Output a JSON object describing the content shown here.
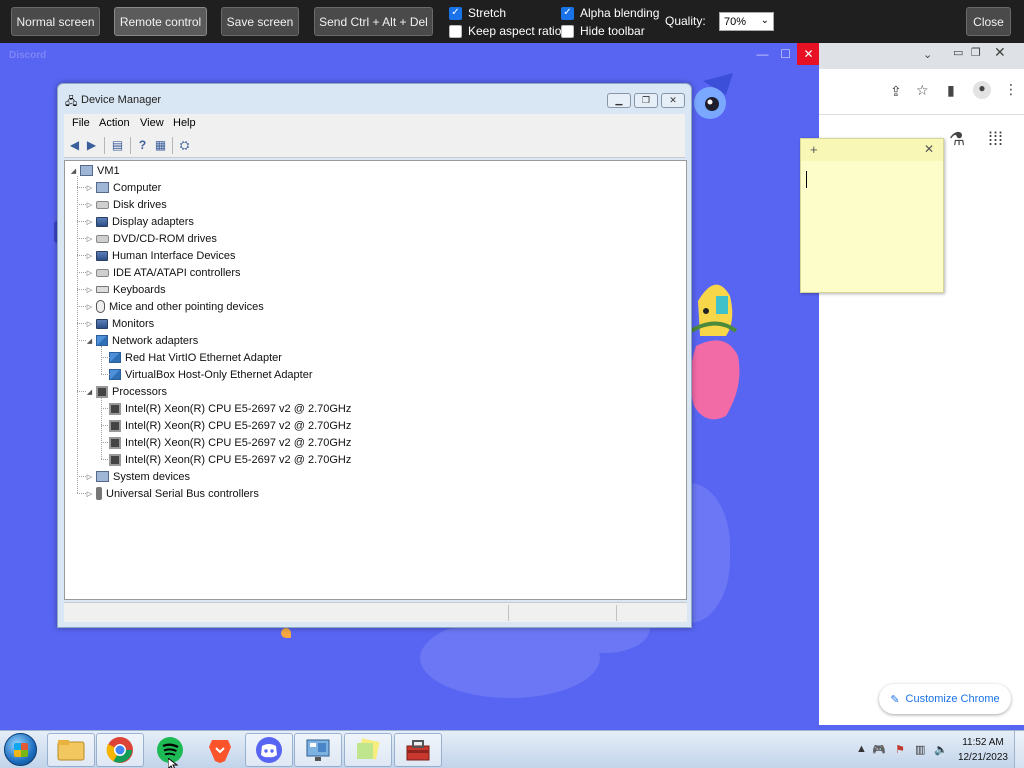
{
  "vnc": {
    "buttons": {
      "normal_screen": "Normal screen",
      "remote_control": "Remote control",
      "save_screen": "Save screen",
      "send_cad": "Send Ctrl + Alt + Del",
      "close": "Close"
    },
    "options": {
      "stretch": {
        "label": "Stretch",
        "checked": true
      },
      "alpha_blending": {
        "label": "Alpha blending",
        "checked": true
      },
      "keep_aspect_ratio": {
        "label": "Keep aspect ratio",
        "checked": false
      },
      "hide_toolbar": {
        "label": "Hide toolbar",
        "checked": false
      }
    },
    "quality_label": "Quality:",
    "quality_value": "70%"
  },
  "discord": {
    "window_title": "Discord"
  },
  "chrome": {
    "customize_label": "Customize Chrome"
  },
  "device_manager": {
    "title": "Device Manager",
    "menu": [
      "File",
      "Action",
      "View",
      "Help"
    ],
    "root": "VM1",
    "categories": [
      {
        "label": "Computer",
        "icon": "computer-icon",
        "expanded": false,
        "children": []
      },
      {
        "label": "Disk drives",
        "icon": "disk-drive-icon",
        "expanded": false,
        "children": []
      },
      {
        "label": "Display adapters",
        "icon": "display-adapter-icon",
        "expanded": false,
        "children": []
      },
      {
        "label": "DVD/CD-ROM drives",
        "icon": "dvd-drive-icon",
        "expanded": false,
        "children": []
      },
      {
        "label": "Human Interface Devices",
        "icon": "hid-icon",
        "expanded": false,
        "children": []
      },
      {
        "label": "IDE ATA/ATAPI controllers",
        "icon": "ide-controller-icon",
        "expanded": false,
        "children": []
      },
      {
        "label": "Keyboards",
        "icon": "keyboard-icon",
        "expanded": false,
        "children": []
      },
      {
        "label": "Mice and other pointing devices",
        "icon": "mouse-icon",
        "expanded": false,
        "children": []
      },
      {
        "label": "Monitors",
        "icon": "monitor-icon",
        "expanded": false,
        "children": []
      },
      {
        "label": "Network adapters",
        "icon": "network-adapter-icon",
        "expanded": true,
        "children": [
          "Red Hat VirtIO Ethernet Adapter",
          "VirtualBox Host-Only Ethernet Adapter"
        ]
      },
      {
        "label": "Processors",
        "icon": "processor-icon",
        "expanded": true,
        "children": [
          "Intel(R) Xeon(R) CPU E5-2697 v2 @ 2.70GHz",
          "Intel(R) Xeon(R) CPU E5-2697 v2 @ 2.70GHz",
          "Intel(R) Xeon(R) CPU E5-2697 v2 @ 2.70GHz",
          "Intel(R) Xeon(R) CPU E5-2697 v2 @ 2.70GHz"
        ]
      },
      {
        "label": "System devices",
        "icon": "system-device-icon",
        "expanded": false,
        "children": []
      },
      {
        "label": "Universal Serial Bus controllers",
        "icon": "usb-icon",
        "expanded": false,
        "children": []
      }
    ]
  },
  "taskbar": {
    "apps": [
      "file-explorer-icon",
      "chrome-icon",
      "spotify-icon",
      "brave-icon",
      "discord-icon",
      "remote-desktop-icon",
      "sticky-notes-icon",
      "toolbox-icon"
    ],
    "clock_time": "11:52 AM",
    "clock_date": "12/21/2023"
  },
  "colors": {
    "discord_blurple": "#5865f2",
    "vnc_toolbar": "#1f1f1f",
    "checkbox_on": "#1a73e8",
    "sticky_note": "#fdfdc9",
    "close_red": "#e81123"
  }
}
